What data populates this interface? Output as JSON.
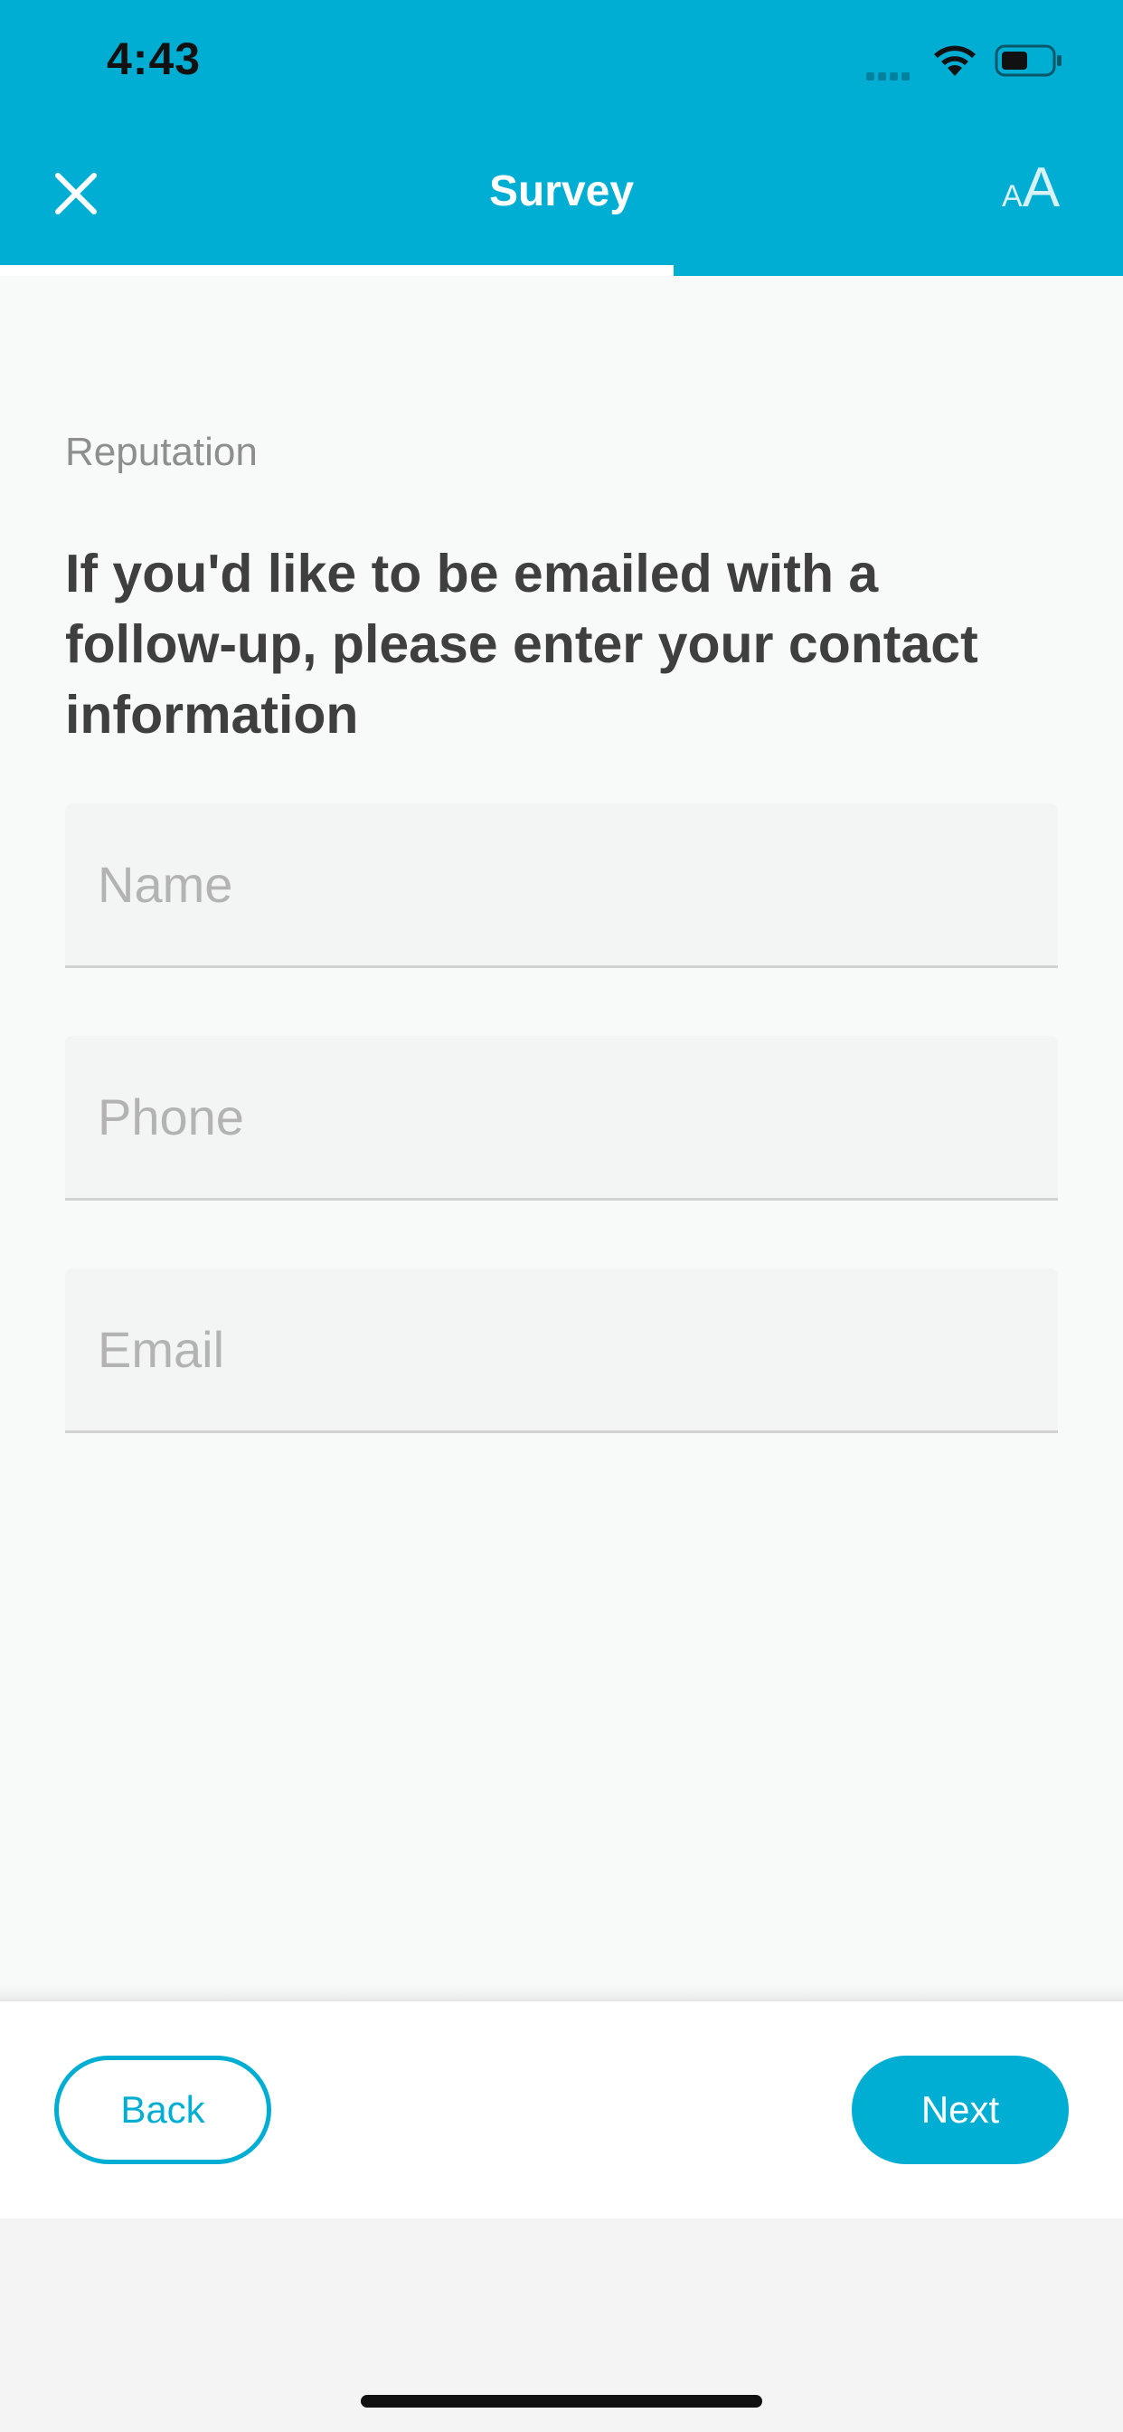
{
  "status_bar": {
    "time": "4:43"
  },
  "header": {
    "title": "Survey",
    "close_icon": "close-icon",
    "text_size_icon": {
      "small": "A",
      "large": "A"
    },
    "progress_percent": 60
  },
  "main": {
    "section_label": "Reputation",
    "question": "If you'd like to be emailed with a follow-up, please enter your contact information",
    "fields": [
      {
        "placeholder": "Name",
        "value": ""
      },
      {
        "placeholder": "Phone",
        "value": ""
      },
      {
        "placeholder": "Email",
        "value": ""
      }
    ]
  },
  "footer": {
    "back_label": "Back",
    "next_label": "Next"
  },
  "colors": {
    "accent": "#00aed4",
    "background": "#f8f9f9",
    "text": "#3f3f3f"
  }
}
